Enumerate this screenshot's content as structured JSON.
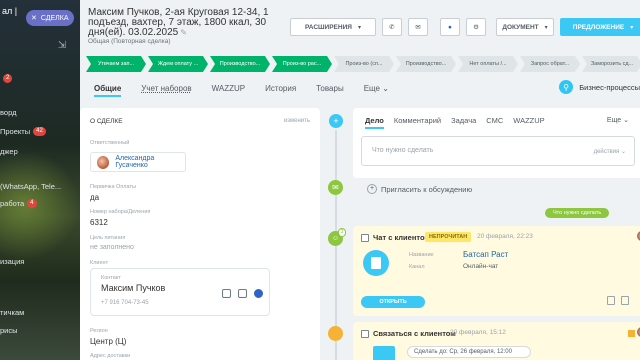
{
  "left_menu": {
    "logo_text": "ал | ",
    "items": [
      {
        "label": "",
        "badge": "2"
      },
      {
        "label": "ворд",
        "badge": ""
      },
      {
        "label": "Проекты",
        "badge": "42"
      },
      {
        "label": "джер",
        "badge": ""
      },
      {
        "label": "(WhatsApp, Tele...",
        "badge": ""
      },
      {
        "label": "работа",
        "badge": "4"
      },
      {
        "label": "",
        "badge": ""
      },
      {
        "label": "изация",
        "badge": ""
      },
      {
        "label": "тичкам",
        "badge": ""
      },
      {
        "label": "рисы",
        "badge": ""
      }
    ]
  },
  "deal_chip": {
    "label": "СДЕЛКА",
    "icon": "close-icon"
  },
  "header": {
    "title": "Максим Пучков, 2-ая Круговая 12-34, 1 подъезд, вахтер, 7 этаж, 1800 ккал, 30 дня(ей). 03.02.2025",
    "subtitle": "Общая (Повторная сделка)",
    "buttons": {
      "extensions": "РАСШИРЕНИЯ",
      "document": "ДОКУМЕНТ",
      "offer": "ПРЕДЛОЖЕНИЕ"
    }
  },
  "stages": [
    {
      "label": "Утвчаем зап...",
      "done": true
    },
    {
      "label": "Ждем оплату ...",
      "done": true
    },
    {
      "label": "Производство...",
      "done": true
    },
    {
      "label": "Произ-во рас...",
      "done": true
    },
    {
      "label": "Произ-во (сп...",
      "done": false
    },
    {
      "label": "Производство...",
      "done": false
    },
    {
      "label": "Нет оплаты /...",
      "done": false
    },
    {
      "label": "Запрос обрат...",
      "done": false
    },
    {
      "label": "Заморозить сд...",
      "done": false
    }
  ],
  "tabs": [
    {
      "label": "Общие",
      "active": true
    },
    {
      "label": "Учет наборов",
      "active": false
    },
    {
      "label": "WAZZUP",
      "active": false
    },
    {
      "label": "История",
      "active": false
    },
    {
      "label": "Товары",
      "active": false
    },
    {
      "label": "Еще",
      "active": false
    }
  ],
  "business_processes": "Бизнес-процессы",
  "about": {
    "heading": "О СДЕЛКЕ",
    "edit": "изменить",
    "responsible_label": "Ответственный",
    "responsible_name": "Александра Гусаченко",
    "first_payment_label": "Первичка Оплаты",
    "first_payment_value": "да",
    "set_number_label": "Номер набора/Деления",
    "set_number_value": "6312",
    "purpose_label": "Цель питания",
    "purpose_value": "не заполнено",
    "client_label": "Клиент",
    "contact_label": "Контакт",
    "contact_name": "Максим Пучков",
    "contact_phone": "+7 916 704-73-45",
    "region_label": "Регион",
    "region_value": "Центр (Ц)",
    "address_label": "Адрес доставки"
  },
  "editor": {
    "tabs": [
      "Дело",
      "Комментарий",
      "Задача",
      "СМС",
      "WAZZUP"
    ],
    "more": "Еще",
    "placeholder": "Что нужно сделать",
    "actions": "действия"
  },
  "timeline": {
    "invite": "Пригласить к обсуждению",
    "todo_pill": "Что нужно сделать",
    "task1": {
      "title": "Чат с клиентом",
      "badge": "НЕПРОЧИТАН",
      "date": "20 февраля, 22:23",
      "name_label": "Название",
      "name_value": "Батсап Раст",
      "channel_label": "Канал",
      "channel_value": "Онлайн-чат",
      "open_button": "ОТКРЫТЬ",
      "counter": "3"
    },
    "task2": {
      "title": "Связаться с клиентом",
      "date": "20 февраля, 15:12",
      "deadline": "Сделать до: Ср, 26 февраля, 12:00"
    }
  },
  "colors": {
    "accent": "#3bc8f5",
    "stage_done": "#00b36b",
    "stage_todo": "#dfe4e7",
    "timeline_green": "#8dc63f",
    "badge_red": "#e2453c",
    "deal_chip": "#6a6fc8"
  }
}
